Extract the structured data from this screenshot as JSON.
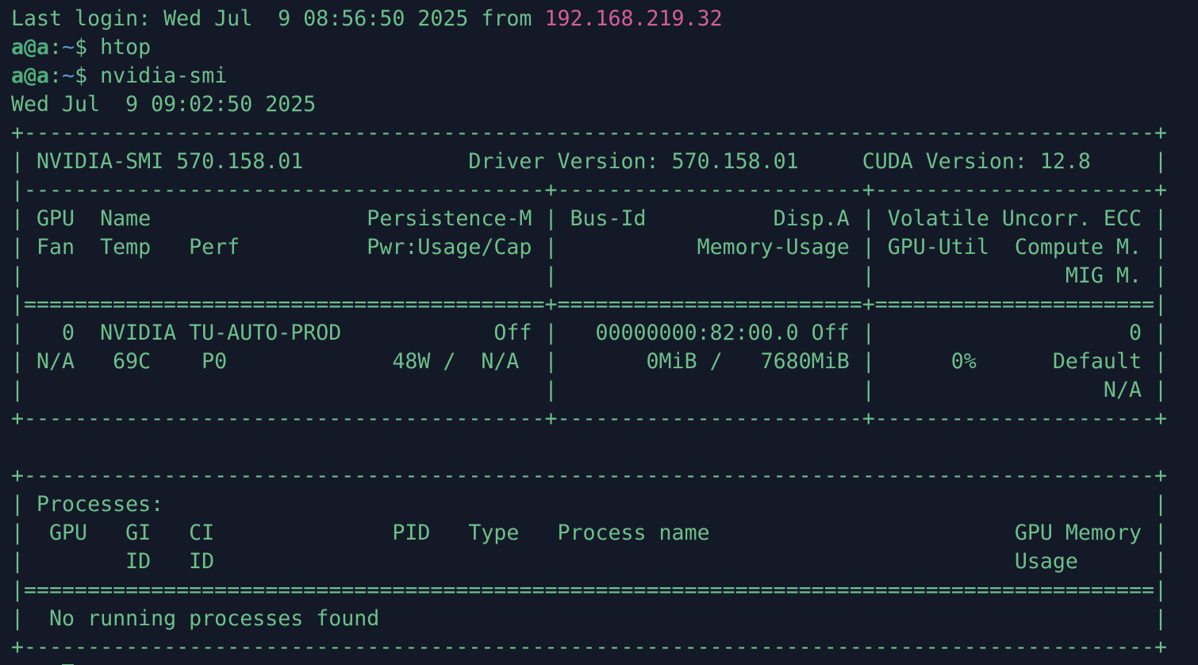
{
  "colors": {
    "background": "#141927",
    "text": "#6cc08b",
    "ip": "#d15f9b",
    "tilde": "#5b9bd5"
  },
  "session": {
    "last_login_prefix": "Last login: Wed Jul  9 08:56:50 2025 from ",
    "last_login_ip": "192.168.219.32",
    "commands": [
      {
        "user": "a@a",
        "sep": ":",
        "path": "~",
        "sym": "$ ",
        "cmd": "htop"
      },
      {
        "user": "a@a",
        "sep": ":",
        "path": "~",
        "sym": "$ ",
        "cmd": "nvidia-smi"
      }
    ],
    "timestamp": "Wed Jul  9 09:02:50 2025"
  },
  "smi_table": {
    "border_top": "+-----------------------------------------------------------------------------------------+",
    "header_line": "| NVIDIA-SMI 570.158.01             Driver Version: 570.158.01     CUDA Version: 12.8     |",
    "sep_dash": "|-----------------------------------------+------------------------+----------------------+",
    "col_head_1": "| GPU  Name                 Persistence-M | Bus-Id          Disp.A | Volatile Uncorr. ECC |",
    "col_head_2": "| Fan  Temp   Perf          Pwr:Usage/Cap |           Memory-Usage | GPU-Util  Compute M. |",
    "col_head_3": "|                                         |                        |               MIG M. |",
    "sep_equal": "|=========================================+========================+======================|",
    "gpu_row_1": "|   0  NVIDIA TU-AUTO-PROD            Off |   00000000:82:00.0 Off |                    0 |",
    "gpu_row_2": "| N/A   69C    P0             48W /  N/A  |       0MiB /   7680MiB |      0%      Default |",
    "gpu_row_3": "|                                         |                        |                  N/A |",
    "border_bottom": "+-----------------------------------------+------------------------+----------------------+"
  },
  "processes_table": {
    "border_top": "+-----------------------------------------------------------------------------------------+",
    "title": "| Processes:                                                                              |",
    "head_1": "|  GPU   GI   CI              PID   Type   Process name                        GPU Memory |",
    "head_2": "|        ID   ID                                                               Usage      |",
    "sep_equal": "|=========================================================================================|",
    "empty_row": "|  No running processes found                                                             |",
    "border_bottom": "+-----------------------------------------------------------------------------------------+"
  }
}
